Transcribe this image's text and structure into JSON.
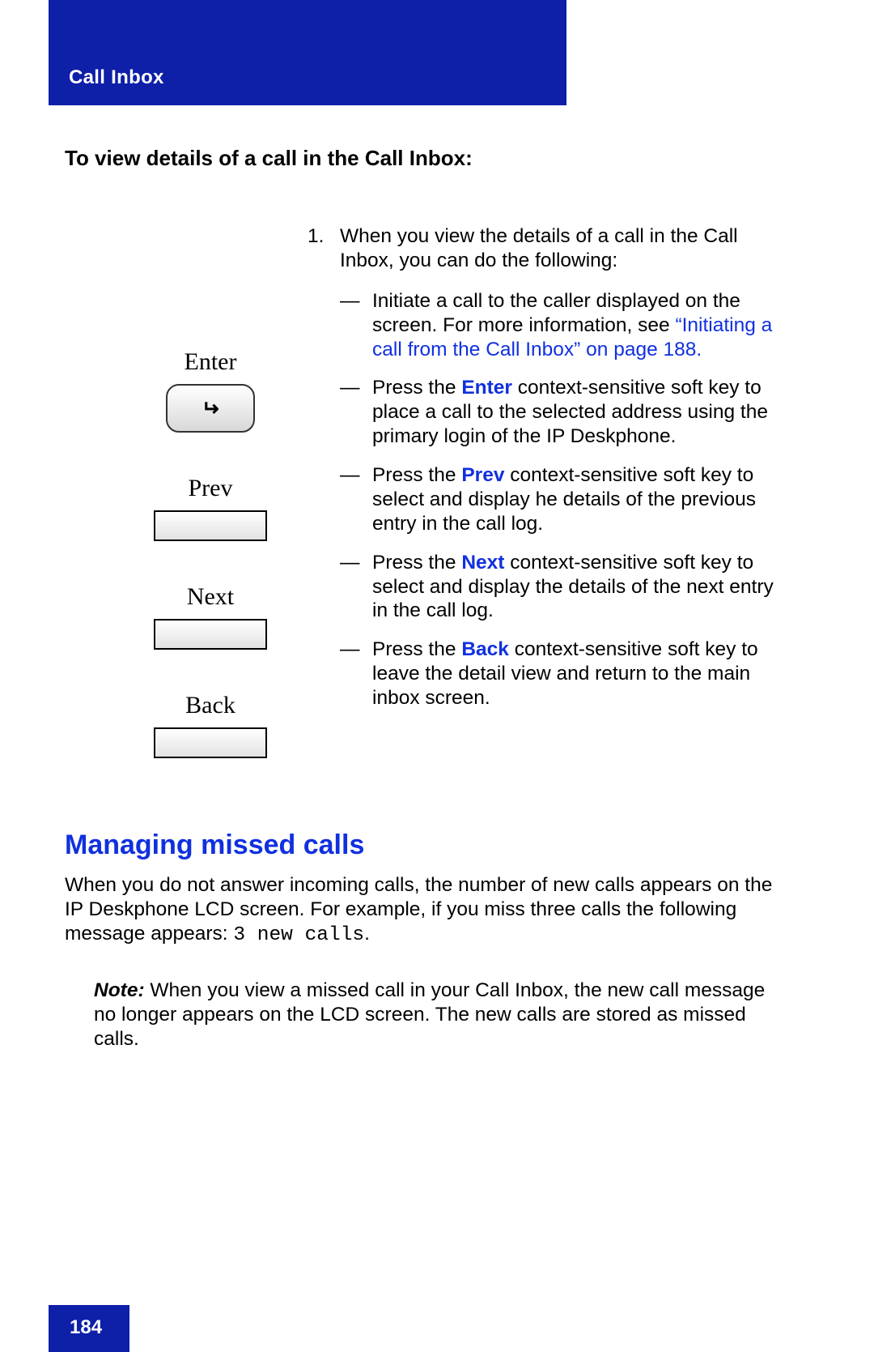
{
  "header": {
    "title": "Call Inbox"
  },
  "lead_heading": "To view details of a call in the Call Inbox:",
  "keys": {
    "enter": {
      "label": "Enter",
      "glyph": "↵"
    },
    "prev": {
      "label": "Prev"
    },
    "next": {
      "label": "Next"
    },
    "back": {
      "label": "Back"
    }
  },
  "step": {
    "number": "1.",
    "intro": "When you view the details of a call in the Call Inbox, you can do the following:",
    "bullets": {
      "b1_pre": "Initiate a call to the caller displayed on the screen. For more information, see ",
      "b1_link": "“Initiating a call from the Call Inbox” on page 188.",
      "b2_pre": "Press the ",
      "b2_key": "Enter",
      "b2_post": " context-sensitive soft key to place a call to the selected address using the primary login of the IP Deskphone.",
      "b3_pre": "Press the ",
      "b3_key": "Prev",
      "b3_post": " context-sensitive soft key to select and display he details of the previous entry in the call log.",
      "b4_pre": "Press the ",
      "b4_key": "Next",
      "b4_post": " context-sensitive soft key to select and display the details of the next entry in the call log.",
      "b5_pre": "Press the ",
      "b5_key": "Back",
      "b5_post": " context-sensitive soft key to leave the detail view and return to the main inbox screen."
    }
  },
  "section": {
    "heading": "Managing missed calls",
    "body_pre": "When you do not answer incoming calls, the number of new calls appears on the IP Deskphone LCD screen. For example, if you miss three calls the following message appears: ",
    "body_code": "3 new calls",
    "body_post": "."
  },
  "note": {
    "label": "Note:",
    "text": "  When you view a missed call in your Call Inbox, the new call message no longer appears on the LCD screen. The new calls are stored as missed calls."
  },
  "footer": {
    "page": "184"
  }
}
